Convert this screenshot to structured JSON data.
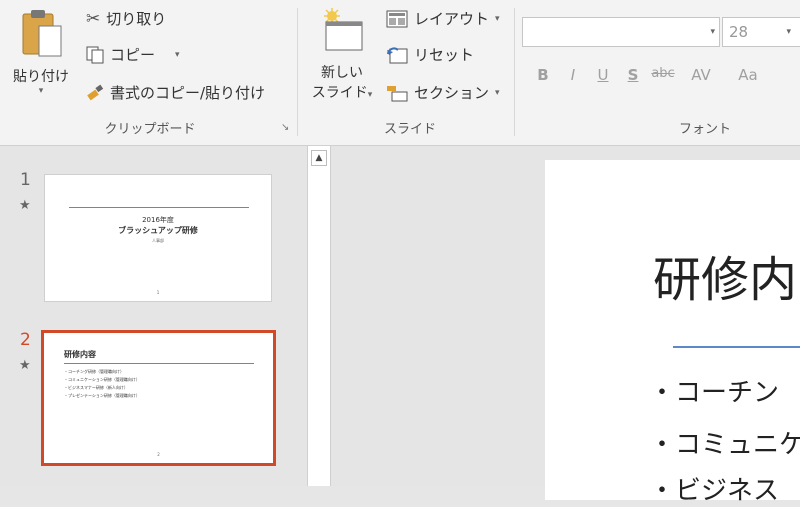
{
  "clipboard": {
    "paste_label_1": "貼り付け",
    "paste_caret": "▾",
    "cut_label": "切り取り",
    "copy_label": "コピー",
    "copy_caret": "▾",
    "format_painter_label": "書式のコピー/貼り付け",
    "group_label": "クリップボード",
    "launcher": "↘"
  },
  "slides_group": {
    "new_slide_line1": "新しい",
    "new_slide_line2": "スライド",
    "new_slide_caret": "▾",
    "layout_label": "レイアウト",
    "layout_caret": "▾",
    "reset_label": "リセット",
    "section_label": "セクション",
    "section_caret": "▾",
    "group_label": "スライド"
  },
  "font_group": {
    "font_name_value": "",
    "font_name_caret": "▾",
    "font_size_value": "28",
    "font_size_caret": "▾",
    "bold": "B",
    "italic": "I",
    "underline": "U",
    "shadow": "S",
    "strikethrough": "abc",
    "spacing": "AV",
    "change_case": "Aa",
    "group_label": "フォント"
  },
  "thumbnails": [
    {
      "number": "1",
      "star": "★",
      "title_line1": "2016年度",
      "title_line2": "ブラッシュアップ研修",
      "subtitle": "人事部",
      "footer": "1"
    },
    {
      "number": "2",
      "star": "★",
      "title": "研修内容",
      "bullets": [
        "・コーチング研修（管理職向け）",
        "・コミュニケーション研修（管理職向け）",
        "・ビジネスマナー研修（新人向け）",
        "・プレゼンテーション研修（管理職向け）"
      ],
      "footer": "2"
    }
  ],
  "slide": {
    "title": "研修内",
    "bullets": [
      "・コーチン",
      "・コミュニケ",
      "・ビジネス"
    ]
  },
  "colors": {
    "accent": "#d04a2a",
    "rule": "#5b8ac6"
  }
}
